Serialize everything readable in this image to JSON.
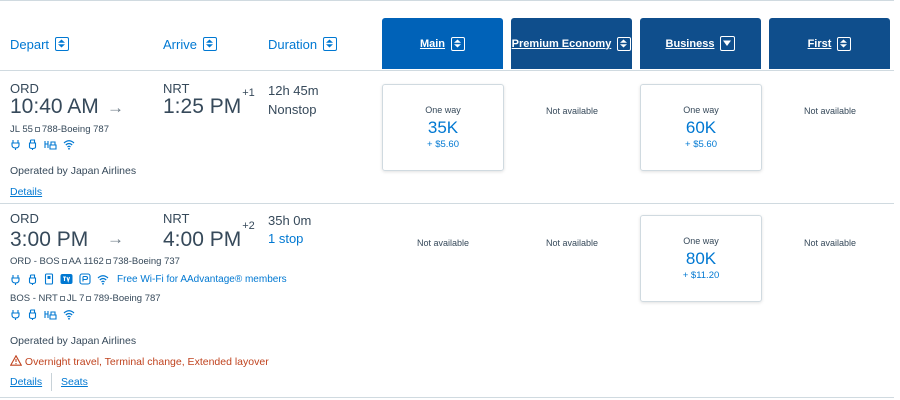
{
  "header": {
    "depart": "Depart",
    "arrive": "Arrive",
    "duration": "Duration",
    "cabins": [
      "Main",
      "Premium Economy",
      "Business",
      "First"
    ]
  },
  "flights": [
    {
      "origin": "ORD",
      "depart_time": "10:40 AM",
      "dest": "NRT",
      "arrive_time": "1:25 PM",
      "day_offset": "+1",
      "duration": "12h 45m",
      "stops": "Nonstop",
      "segments": [
        {
          "flight": "JL 55",
          "aircraft": "788-Boeing 787"
        }
      ],
      "operated_by": "Operated by Japan Airlines",
      "links": [
        "Details"
      ],
      "fares": {
        "main": {
          "label": "One way",
          "miles": "35K",
          "fee": "+ $5.60"
        },
        "premium": {
          "text": "Not available"
        },
        "business": {
          "label": "One way",
          "miles": "60K",
          "fee": "+ $5.60"
        },
        "first": {
          "text": "Not available"
        }
      }
    },
    {
      "origin": "ORD",
      "depart_time": "3:00 PM",
      "dest": "NRT",
      "arrive_time": "4:00 PM",
      "day_offset": "+2",
      "duration": "35h 0m",
      "stops": "1 stop",
      "segments": [
        {
          "route": "ORD - BOS",
          "flight": "AA 1162",
          "aircraft": "738-Boeing 737",
          "wifi_note": "Free Wi-Fi for AAdvantage® members"
        },
        {
          "route": "BOS - NRT",
          "flight": "JL 7",
          "aircraft": "789-Boeing 787"
        }
      ],
      "operated_by": "Operated by Japan Airlines",
      "warning": "Overnight travel, Terminal change, Extended layover",
      "links": [
        "Details",
        "Seats"
      ],
      "fares": {
        "main": {
          "text": "Not available"
        },
        "premium": {
          "text": "Not available"
        },
        "business": {
          "label": "One way",
          "miles": "80K",
          "fee": "+ $11.20"
        },
        "first": {
          "text": "Not available"
        }
      }
    }
  ],
  "colors": {
    "accent": "#0078d2",
    "cabin_header": "#0f4e8c",
    "cabin_header_active": "#0062b8",
    "warning": "#c0431f",
    "text": "#36495a"
  },
  "icons": [
    "sort-icon",
    "sort-down-icon",
    "arrow-right-icon",
    "power-outlet-icon",
    "usb-icon",
    "entertainment-icon",
    "wifi-icon",
    "seatback-screen-icon",
    "warning-icon"
  ]
}
